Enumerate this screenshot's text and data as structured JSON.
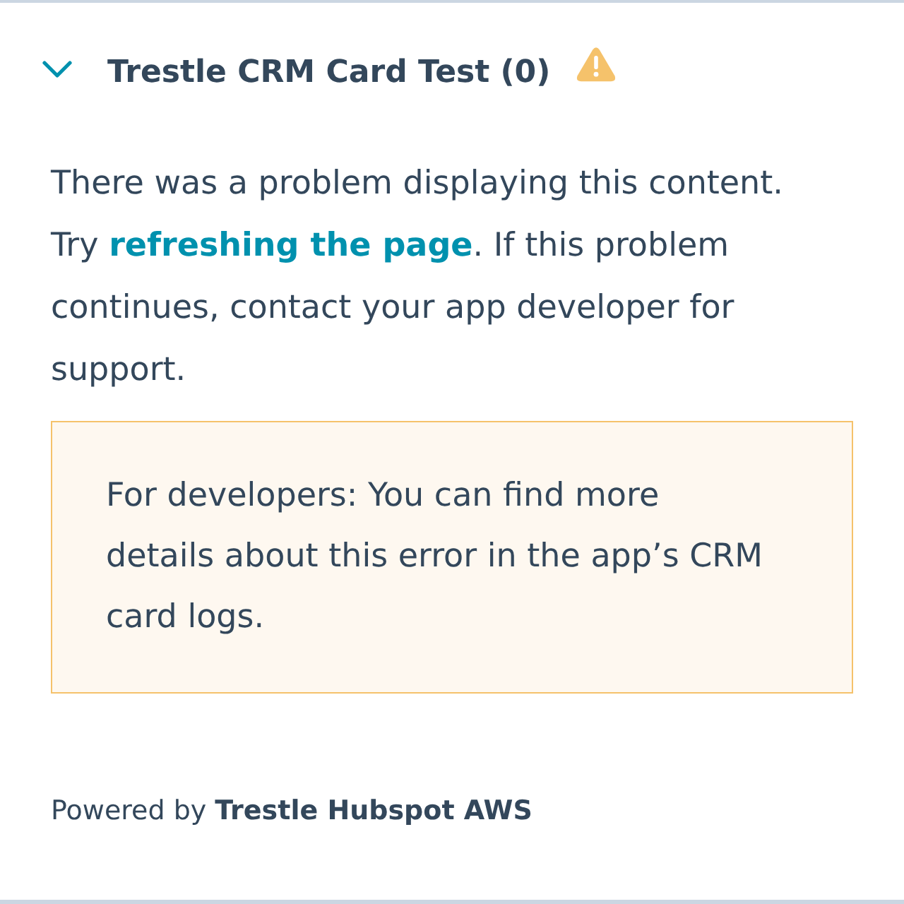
{
  "card": {
    "title": "Trestle CRM Card Test (0)",
    "expanded": true
  },
  "error": {
    "message_start": "There was a problem displaying this content. Try",
    "link": "refreshing the page",
    "message_end": ". If this problem continues, contact your app developer for support."
  },
  "developer_note": "For developers: You can find more details about this error in the app’s CRM card logs.",
  "footer": "Powered by **Trestle Hubspot AWS**"
}
